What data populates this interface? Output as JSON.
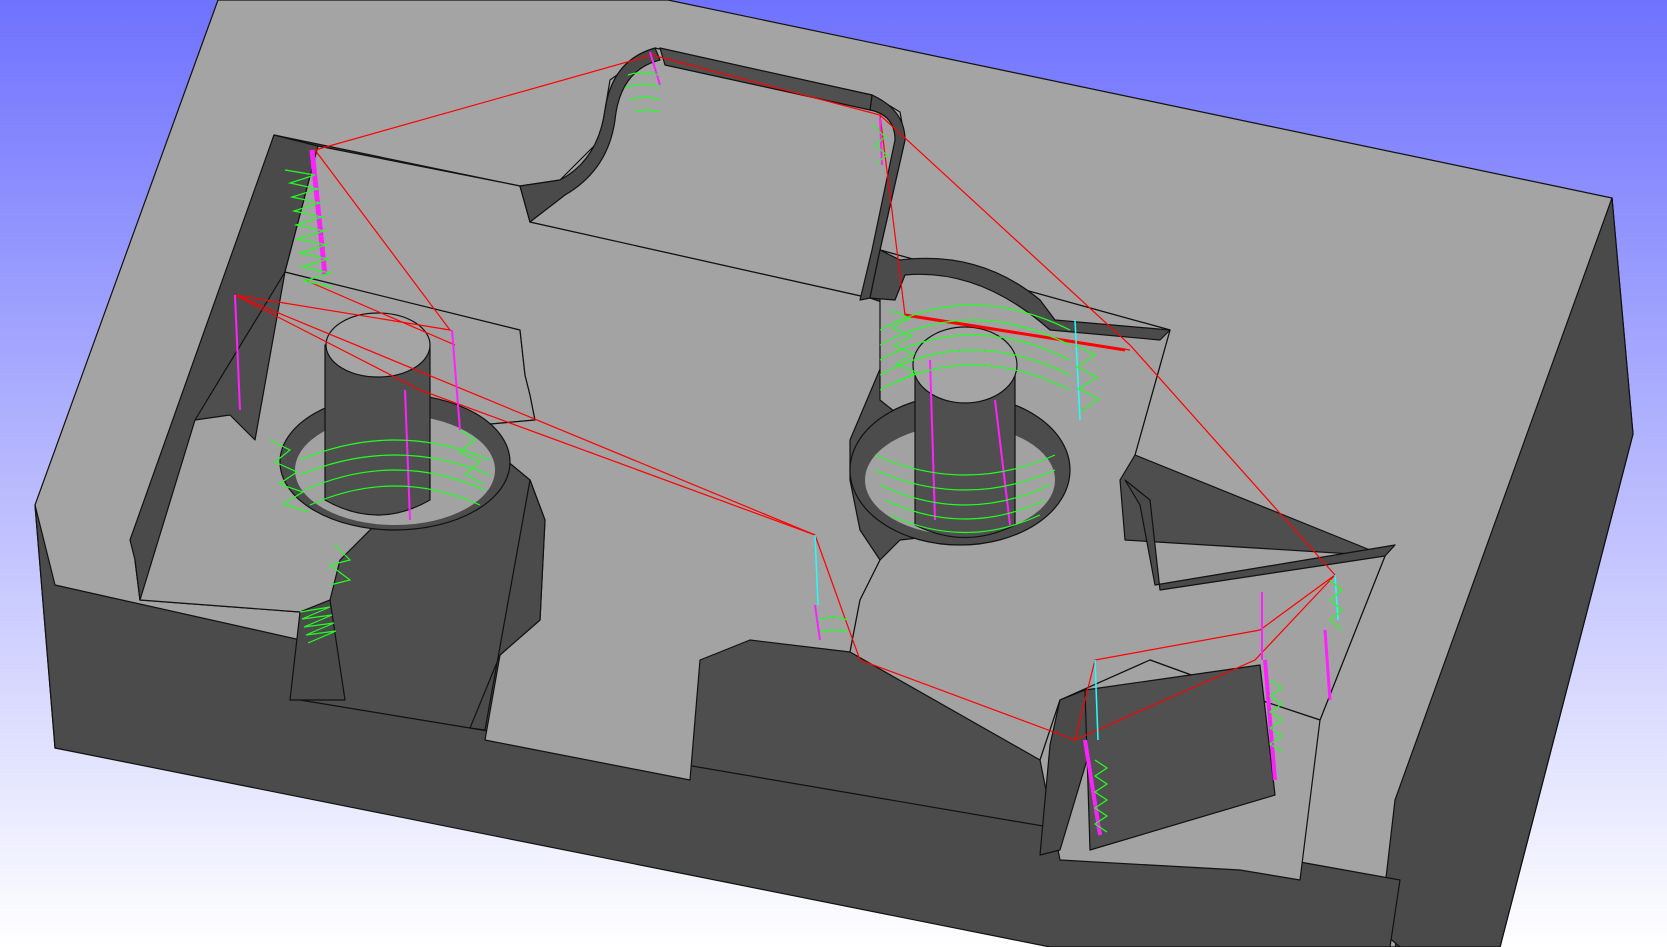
{
  "viewport": {
    "background_top": "#6f72fe",
    "background_bottom": "#ffffff"
  },
  "model": {
    "top_face_color": "#a4a4a4",
    "side_face_color": "#4d4d4d",
    "pocket_floor_color": "#a0a0a0",
    "edge_color": "#111111"
  },
  "toolpaths": {
    "rapid_color": "#ff0000",
    "cut_color": "#22ff22",
    "plunge_color": "#ff22ff",
    "retract_color": "#22ffff"
  }
}
